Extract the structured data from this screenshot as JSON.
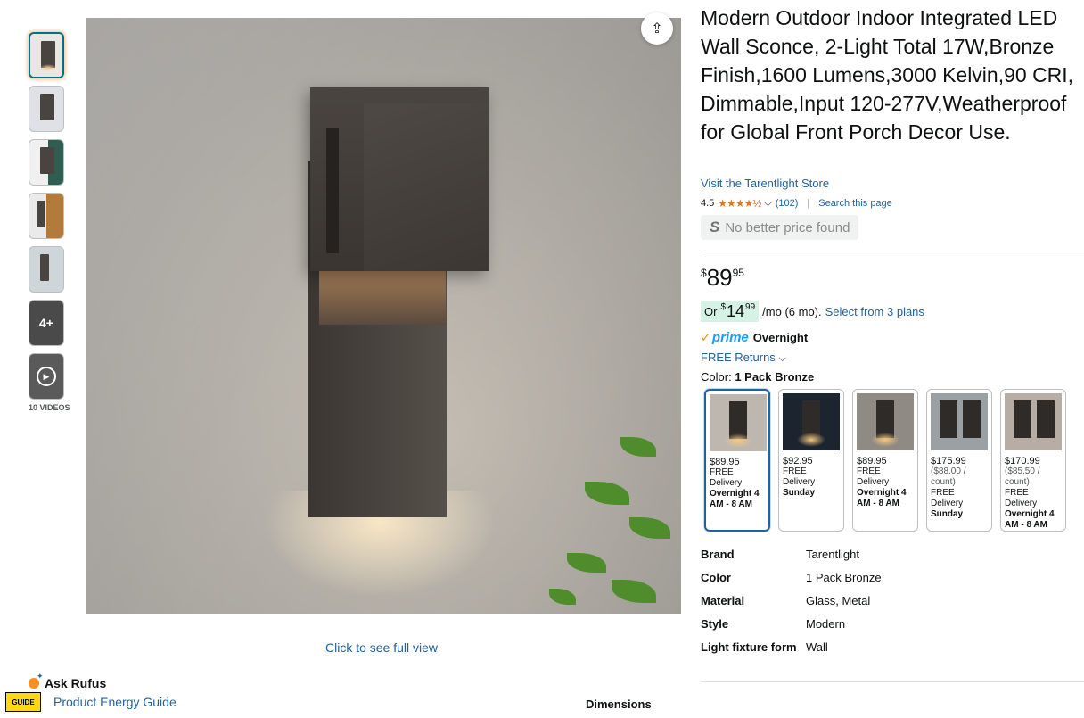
{
  "gallery": {
    "more_label": "4+",
    "videos_label": "10 VIDEOS",
    "full_view_label": "Click to see full view",
    "share_icon": "share-icon"
  },
  "product": {
    "title": "Modern Outdoor Indoor Integrated LED Wall Sconce, 2-Light Total 17W,Bronze Finish,1600 Lumens,3000 Kelvin,90 CRI, Dimmable,Input 120-277V,Weatherproof for Global Front Porch Decor Use.",
    "store_link": "Visit the Tarentlight Store",
    "rating": "4.5",
    "stars": "★★★★½",
    "review_count": "(102)",
    "search_page": "Search this page",
    "no_better_price": "No better price found",
    "price_symbol": "$",
    "price_whole": "89",
    "price_fraction": "95",
    "monthly_or": "Or",
    "monthly_symbol": "$",
    "monthly_whole": "14",
    "monthly_fraction": "99",
    "monthly_suffix": "/mo (6 mo).",
    "monthly_link": "Select from 3 plans",
    "prime_label": "prime",
    "prime_delivery": "Overnight",
    "free_returns": "FREE Returns",
    "color_label": "Color:",
    "color_value": "1 Pack Bronze"
  },
  "swatches": [
    {
      "price": "$89.95",
      "unit": "",
      "delivery": "FREE Delivery",
      "when": "Overnight 4 AM - 8 AM"
    },
    {
      "price": "$92.95",
      "unit": "",
      "delivery": "FREE Delivery",
      "when": "Sunday"
    },
    {
      "price": "$89.95",
      "unit": "",
      "delivery": "FREE Delivery",
      "when": "Overnight 4 AM - 8 AM"
    },
    {
      "price": "$175.99",
      "unit": "($88.00 / count)",
      "delivery": "FREE Delivery",
      "when": "Sunday"
    },
    {
      "price": "$170.99",
      "unit": "($85.50 / count)",
      "delivery": "FREE Delivery",
      "when": "Overnight 4 AM - 8 AM"
    }
  ],
  "specs": [
    {
      "key": "Brand",
      "value": "Tarentlight"
    },
    {
      "key": "Color",
      "value": "1 Pack Bronze"
    },
    {
      "key": "Material",
      "value": "Glass, Metal"
    },
    {
      "key": "Style",
      "value": "Modern"
    },
    {
      "key": "Light fixture form",
      "value": "Wall"
    }
  ],
  "footer": {
    "ask_rufus": "Ask Rufus",
    "energy_badge": "GUIDE",
    "energy_link": "Product Energy Guide",
    "dimensions": "Dimensions"
  }
}
